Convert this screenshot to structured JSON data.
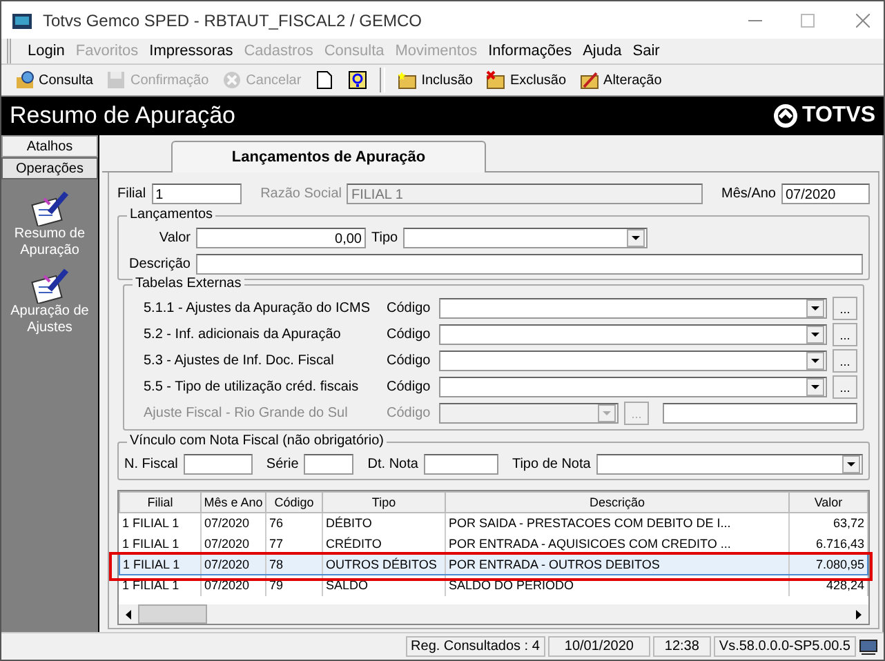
{
  "window": {
    "title": "Totvs Gemco SPED - RBTAUT_FISCAL2 / GEMCO"
  },
  "menu": [
    {
      "label": "Login",
      "disabled": false
    },
    {
      "label": "Favoritos",
      "disabled": true
    },
    {
      "label": "Impressoras",
      "disabled": false
    },
    {
      "label": "Cadastros",
      "disabled": true
    },
    {
      "label": "Consulta",
      "disabled": true
    },
    {
      "label": "Movimentos",
      "disabled": true
    },
    {
      "label": "Informações",
      "disabled": false
    },
    {
      "label": "Ajuda",
      "disabled": false
    },
    {
      "label": "Sair",
      "disabled": false
    }
  ],
  "toolbar": [
    {
      "kind": "search",
      "label": "Consulta",
      "disabled": false
    },
    {
      "kind": "save",
      "label": "Confirmação",
      "disabled": true
    },
    {
      "kind": "cancel",
      "label": "Cancelar",
      "disabled": true
    },
    {
      "kind": "new",
      "disabled": false
    },
    {
      "kind": "help",
      "disabled": false
    },
    {
      "kind": "sep"
    },
    {
      "kind": "add",
      "label": "Inclusão",
      "disabled": false
    },
    {
      "kind": "delete",
      "label": "Exclusão",
      "disabled": false
    },
    {
      "kind": "edit",
      "label": "Alteração",
      "disabled": false
    }
  ],
  "header": {
    "title": "Resumo de Apuração",
    "logo": "TOTVS"
  },
  "sidebar": {
    "tabs": [
      {
        "label": "Atalhos",
        "selected": false
      },
      {
        "label": "Operações",
        "selected": true
      }
    ],
    "items": [
      {
        "label": "Resumo de Apuração"
      },
      {
        "label": "Apuração de Ajustes"
      }
    ]
  },
  "tab": {
    "label": "Lançamentos de Apuração",
    "selected": true
  },
  "filial": {
    "label": "Filial",
    "value": "1"
  },
  "razao_social": {
    "label": "Razão Social",
    "value": "FILIAL 1",
    "disabled": true
  },
  "mes_ano": {
    "label": "Mês/Ano",
    "value": "07/2020"
  },
  "lancamentos": {
    "legend": "Lançamentos",
    "valor": {
      "label": "Valor",
      "value": "0,00"
    },
    "tipo": {
      "label": "Tipo"
    },
    "descricao": {
      "label": "Descrição"
    }
  },
  "tabelas_externas": {
    "legend": "Tabelas Externas",
    "rows": [
      {
        "label": "5.1.1 - Ajustes da Apuração do ICMS",
        "code_label": "Código",
        "button": "...",
        "disabled": false
      },
      {
        "label": "5.2 - Inf. adicionais da Apuração",
        "code_label": "Código",
        "button": "...",
        "disabled": false
      },
      {
        "label": "5.3 - Ajustes de Inf. Doc. Fiscal",
        "code_label": "Código",
        "button": "...",
        "disabled": false
      },
      {
        "label": "5.5 - Tipo de utilização créd. fiscais",
        "code_label": "Código",
        "button": "...",
        "disabled": false
      },
      {
        "label": "Ajuste Fiscal - Rio Grande do Sul",
        "code_label": "Código",
        "button": "...",
        "disabled": true
      }
    ]
  },
  "vinculo": {
    "legend": "Vínculo com Nota Fiscal (não obrigatório)",
    "n_fiscal": {
      "label": "N. Fiscal"
    },
    "serie": {
      "label": "Série"
    },
    "dt_nota": {
      "label": "Dt. Nota"
    },
    "tipo_nota": {
      "label": "Tipo de Nota"
    }
  },
  "table": {
    "columns": [
      "Filial",
      "Mês e Ano",
      "Código",
      "Tipo",
      "Descrição",
      "Valor"
    ],
    "rows": [
      {
        "cells": [
          "1 FILIAL 1",
          "07/2020",
          "76",
          "DÉBITO",
          "POR SAIDA - PRESTACOES COM DEBITO DE I...",
          "63,72"
        ],
        "selected": false
      },
      {
        "cells": [
          "1 FILIAL 1",
          "07/2020",
          "77",
          "CRÉDITO",
          "POR ENTRADA - AQUISICOES COM CREDITO ...",
          "6.716,43"
        ],
        "selected": false
      },
      {
        "cells": [
          "1 FILIAL 1",
          "07/2020",
          "78",
          "OUTROS DÉBITOS",
          "POR ENTRADA - OUTROS DEBITOS",
          "7.080,95"
        ],
        "selected": true
      },
      {
        "cells": [
          "1 FILIAL 1",
          "07/2020",
          "79",
          "SALDO",
          "SALDO DO PERIODO",
          "428,24"
        ],
        "selected": false
      }
    ]
  },
  "status_bar": [
    "Reg. Consultados : 4",
    "10/01/2020",
    "12:38",
    "Vs.58.0.0.0-SP5.00.5"
  ]
}
